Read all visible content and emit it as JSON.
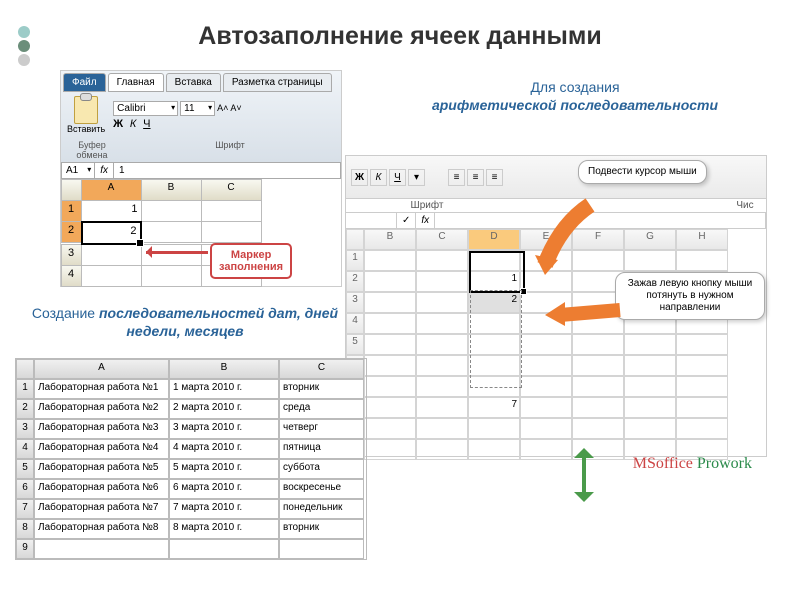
{
  "title": "Автозаполнение  ячеек  данными",
  "shot1": {
    "tabs": {
      "file": "Файл",
      "home": "Главная",
      "insert": "Вставка",
      "layout": "Разметка страницы"
    },
    "paste": "Вставить",
    "font": "Calibri",
    "size": "11",
    "clipboard_label": "Буфер обмена",
    "font_label": "Шрифт",
    "namebox": "A1",
    "fx": "fx",
    "fvalue": "1",
    "cols": [
      "",
      "A",
      "B",
      "C"
    ],
    "r1": "1",
    "r2": "2",
    "v1": "1",
    "v2": "2"
  },
  "callout_marker": "Маркер\nзаполнения",
  "right_head": {
    "t1": "Для создания",
    "t2": "арифметической последовательности"
  },
  "shot2": {
    "font_label": "Шрифт",
    "extra_label": "Чис",
    "fx": "fx",
    "cols": [
      "",
      "B",
      "C",
      "D",
      "E",
      "F",
      "G",
      "H"
    ],
    "d2": "1",
    "d3": "2",
    "d8": "7",
    "speech1": "Подвести\nкурсор мыши",
    "speech2": "Зажав левую кнопку\nмыши потянуть в\nнужном направлении",
    "watermark": {
      "p1": "MSoffice",
      "p2": " Prowork"
    }
  },
  "subtitle": {
    "t1": "Создание ",
    "t2": "последовательностей дат, дней недели, месяцев"
  },
  "table2": {
    "cols": [
      "",
      "A",
      "B",
      "C"
    ],
    "rows": [
      [
        "1",
        "Лабораторная работа №1",
        "1 марта 2010 г.",
        "вторник"
      ],
      [
        "2",
        "Лабораторная работа №2",
        "2 марта 2010 г.",
        "среда"
      ],
      [
        "3",
        "Лабораторная работа №3",
        "3 марта 2010 г.",
        "четверг"
      ],
      [
        "4",
        "Лабораторная работа №4",
        "4 марта 2010 г.",
        "пятница"
      ],
      [
        "5",
        "Лабораторная работа №5",
        "5 марта 2010 г.",
        "суббота"
      ],
      [
        "6",
        "Лабораторная работа №6",
        "6 марта 2010 г.",
        "воскресенье"
      ],
      [
        "7",
        "Лабораторная работа №7",
        "7 марта 2010 г.",
        "понедельник"
      ],
      [
        "8",
        "Лабораторная работа №8",
        "8 марта 2010 г.",
        "вторник"
      ],
      [
        "9",
        "",
        "",
        ""
      ]
    ]
  }
}
